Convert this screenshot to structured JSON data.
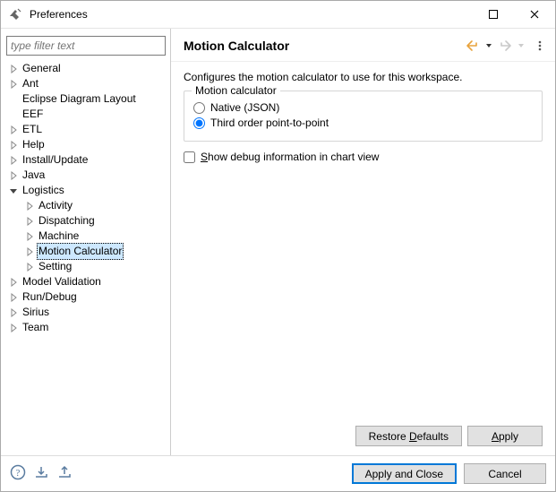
{
  "window": {
    "title": "Preferences"
  },
  "sidebar": {
    "filter_placeholder": "type filter text",
    "items": [
      {
        "label": "General",
        "expandable": true
      },
      {
        "label": "Ant",
        "expandable": true
      },
      {
        "label": "Eclipse Diagram Layout",
        "expandable": false
      },
      {
        "label": "EEF",
        "expandable": false
      },
      {
        "label": "ETL",
        "expandable": true
      },
      {
        "label": "Help",
        "expandable": true
      },
      {
        "label": "Install/Update",
        "expandable": true
      },
      {
        "label": "Java",
        "expandable": true
      },
      {
        "label": "Logistics",
        "expanded": true,
        "children": [
          {
            "label": "Activity",
            "expandable": true
          },
          {
            "label": "Dispatching",
            "expandable": true
          },
          {
            "label": "Machine",
            "expandable": true
          },
          {
            "label": "Motion Calculator",
            "expandable": true,
            "selected": true
          },
          {
            "label": "Setting",
            "expandable": true
          }
        ]
      },
      {
        "label": "Model Validation",
        "expandable": true
      },
      {
        "label": "Run/Debug",
        "expandable": true
      },
      {
        "label": "Sirius",
        "expandable": true
      },
      {
        "label": "Team",
        "expandable": true
      }
    ]
  },
  "page": {
    "title": "Motion Calculator",
    "description": "Configures the motion calculator to use for this workspace.",
    "group_legend": "Motion calculator",
    "radio_native": "Native (JSON)",
    "radio_third": "Third order point-to-point",
    "radio_selected": "third",
    "checkbox_pre": "",
    "checkbox_label_html": "Show debug information in chart view",
    "checkbox_mnemonic": "S",
    "checkbox_checked": false
  },
  "buttons": {
    "restore_defaults": "Restore Defaults",
    "restore_mnemonic": "D",
    "apply": "Apply",
    "apply_mnemonic": "A",
    "apply_close": "Apply and Close",
    "cancel": "Cancel"
  }
}
